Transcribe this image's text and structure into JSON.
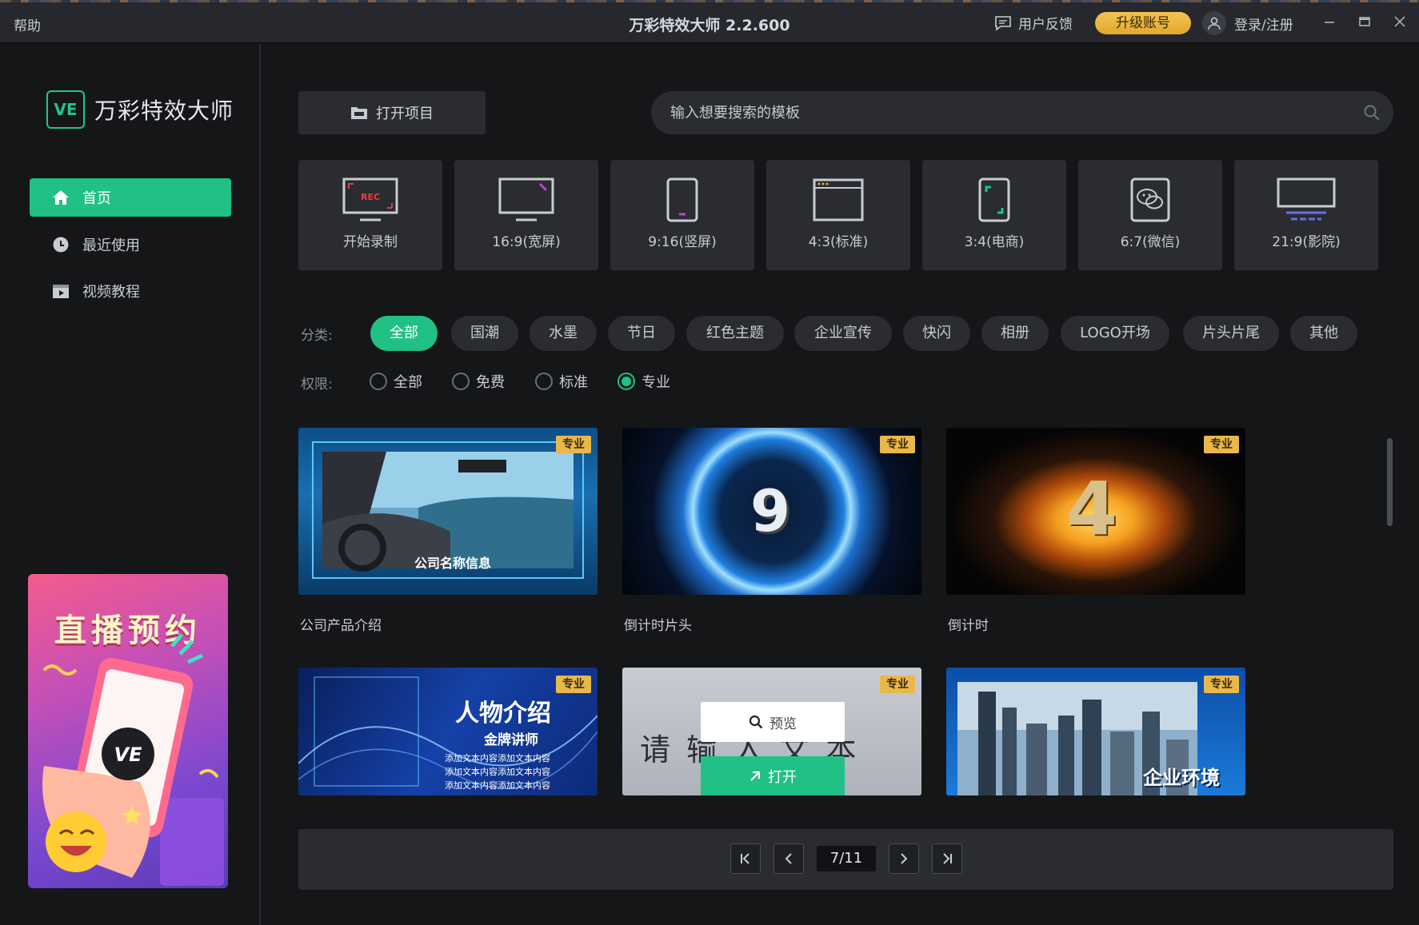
{
  "titlebar": {
    "help": "帮助",
    "title": "万彩特效大师 2.2.600",
    "feedback": "用户反馈",
    "upgrade": "升级账号",
    "login": "登录/注册"
  },
  "sidebar": {
    "logo_mark": "VE",
    "logo_text": "万彩特效大师",
    "items": [
      {
        "label": "首页",
        "icon": "home-icon"
      },
      {
        "label": "最近使用",
        "icon": "clock-icon"
      },
      {
        "label": "视频教程",
        "icon": "video-tutorial-icon"
      }
    ],
    "promo_title": "直播预约",
    "promo_mark": "VE"
  },
  "toolbar": {
    "open_project": "打开项目",
    "search_placeholder": "输入想要搜索的模板"
  },
  "ratios": [
    {
      "label": "开始录制",
      "icon": "record-screen-icon",
      "icon_text": "REC"
    },
    {
      "label": "16:9(宽屏)",
      "icon": "widescreen-icon"
    },
    {
      "label": "9:16(竖屏)",
      "icon": "portrait-phone-icon"
    },
    {
      "label": "4:3(标准)",
      "icon": "standard-window-icon"
    },
    {
      "label": "3:4(电商)",
      "icon": "ecommerce-phone-icon"
    },
    {
      "label": "6:7(微信)",
      "icon": "wechat-icon"
    },
    {
      "label": "21:9(影院)",
      "icon": "cinema-icon"
    }
  ],
  "filters": {
    "category_label": "分类:",
    "categories": [
      "全部",
      "国潮",
      "水墨",
      "节日",
      "红色主题",
      "企业宣传",
      "快闪",
      "相册",
      "LOGO开场",
      "片头片尾",
      "其他"
    ],
    "active_category": "全部",
    "permission_label": "权限:",
    "permissions": [
      "全部",
      "免费",
      "标准",
      "专业"
    ],
    "selected_permission": "专业"
  },
  "templates": [
    {
      "title": "公司产品介绍",
      "badge": "专业",
      "thumb_text": "公司名称信息"
    },
    {
      "title": "倒计时片头",
      "badge": "专业",
      "thumb_text": "9"
    },
    {
      "title": "倒计时",
      "badge": "专业",
      "thumb_text": "4"
    },
    {
      "title": "",
      "badge": "专业",
      "thumb_text": "人物介绍",
      "thumb_sub": "金牌讲师",
      "thumb_lines": [
        "添加文本内容添加文本内容",
        "添加文本内容添加文本内容",
        "添加文本内容添加文本内容"
      ]
    },
    {
      "title": "",
      "badge": "专业",
      "thumb_text": "请 输 入 文 本",
      "preview": "预览",
      "open": "打开"
    },
    {
      "title": "",
      "badge": "专业",
      "thumb_text": "企业环境"
    }
  ],
  "pagination": {
    "current": 7,
    "total": 11,
    "display": "7/11"
  },
  "colors": {
    "accent": "#21c085",
    "upgrade": "#e9b84a",
    "background": "#151618",
    "panel": "#2a2c31"
  }
}
